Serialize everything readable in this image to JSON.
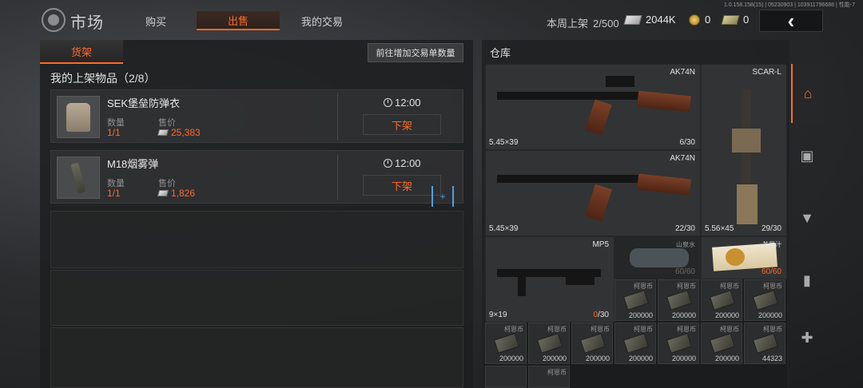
{
  "version_text": "1.0.158.158(15) | 05230903 | 103911796688 | 性能-7",
  "header": {
    "title": "市场",
    "tabs": [
      {
        "label": "购买",
        "active": false
      },
      {
        "label": "出售",
        "active": true
      },
      {
        "label": "我的交易",
        "active": false
      }
    ],
    "weekly_label": "本周上架",
    "weekly_count": "2/500",
    "cash": "2044K",
    "coins": "0",
    "bills": "0",
    "back_icon": "chevron-left-icon"
  },
  "left": {
    "shelf_tab": "货架",
    "add_order_button": "前往增加交易单数量",
    "list_title": "我的上架物品（2/8）",
    "qty_label": "数量",
    "price_label": "售价",
    "items": [
      {
        "name": "SEK堡垒防弹衣",
        "qty": "1/1",
        "price": "25,383",
        "time": "12:00",
        "delist": "下架"
      },
      {
        "name": "M18烟雾弹",
        "qty": "1/1",
        "price": "1,826",
        "time": "12:00",
        "delist": "下架"
      }
    ],
    "plus": "+"
  },
  "warehouse": {
    "title": "仓库",
    "guns": [
      {
        "name": "AK74N",
        "caliber": "5.45×39",
        "ammo": "6/30"
      },
      {
        "name": "AK74N",
        "caliber": "5.45×39",
        "ammo": "22/30"
      },
      {
        "name": "SCAR-L",
        "caliber": "5.56×45",
        "ammo": "29/30"
      },
      {
        "name": "MP5",
        "caliber": "9×19",
        "ammo_current": "0",
        "ammo_max": "/30"
      }
    ],
    "bottle": {
      "name": "山泉水",
      "value": "60/60"
    },
    "juice": {
      "name": "芒果汁",
      "value": "60/60"
    },
    "currency_name": "柯恩币",
    "stacks": [
      "200000",
      "200000",
      "200000",
      "200000",
      "200000",
      "200000",
      "200000",
      "200000",
      "200000",
      "200000",
      "200000",
      "44323"
    ],
    "partial_label": "柯恩币"
  },
  "side_nav": [
    "home-icon",
    "box-icon",
    "shirt-icon",
    "magazine-icon",
    "medkit-icon"
  ],
  "colors": {
    "accent": "#ff6a2a",
    "highlight": "#4fa0e8"
  }
}
